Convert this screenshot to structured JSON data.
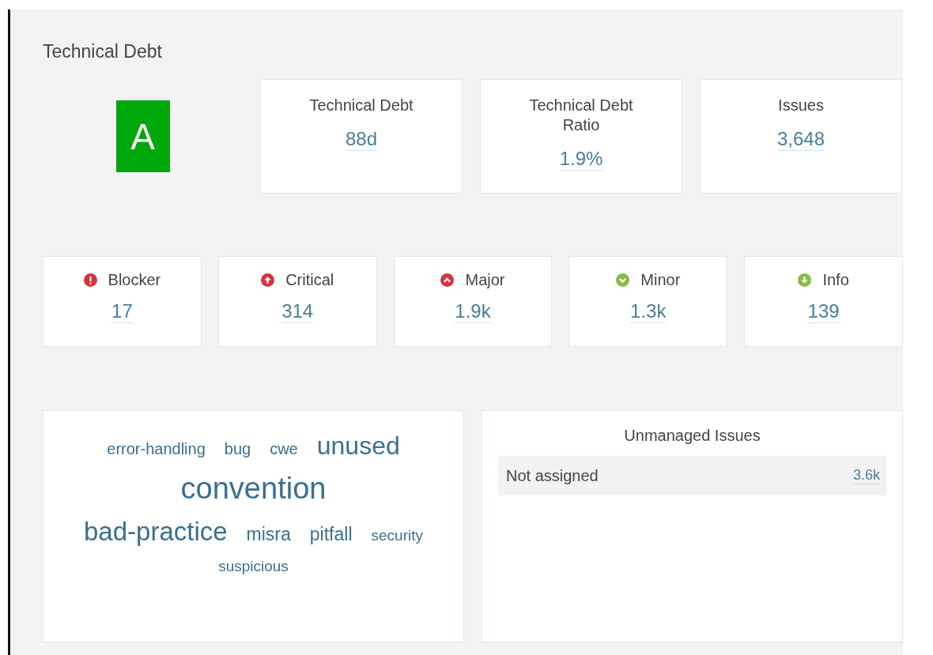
{
  "title": "Technical Debt",
  "rating": {
    "grade": "A",
    "color": "#00a80c"
  },
  "metrics": [
    {
      "label": "Technical Debt",
      "value": "88d"
    },
    {
      "label": "Technical Debt Ratio",
      "value": "1.9%"
    },
    {
      "label": "Issues",
      "value": "3,648"
    }
  ],
  "severities": [
    {
      "kind": "blocker",
      "label": "Blocker",
      "value": "17"
    },
    {
      "kind": "critical",
      "label": "Critical",
      "value": "314"
    },
    {
      "kind": "major",
      "label": "Major",
      "value": "1.9k"
    },
    {
      "kind": "minor",
      "label": "Minor",
      "value": "1.3k"
    },
    {
      "kind": "info",
      "label": "Info",
      "value": "139"
    }
  ],
  "tag_cloud": {
    "tags": [
      {
        "tag": "error-handling",
        "kind": "small"
      },
      {
        "tag": "bug",
        "kind": "small"
      },
      {
        "tag": "cwe",
        "kind": "small"
      },
      {
        "tag": "unused",
        "kind": "large"
      },
      {
        "tag": "convention",
        "kind": "huge"
      },
      {
        "tag": "bad-practice",
        "kind": "xlarge"
      },
      {
        "tag": "misra",
        "kind": "medium"
      },
      {
        "tag": "pitfall",
        "kind": "medium"
      },
      {
        "tag": "security",
        "kind": "tiny"
      },
      {
        "tag": "suspicious",
        "kind": "tiny"
      }
    ]
  },
  "unmanaged_issues": {
    "title": "Unmanaged Issues",
    "rows": [
      {
        "label": "Not assigned",
        "value": "3.6k"
      }
    ]
  }
}
